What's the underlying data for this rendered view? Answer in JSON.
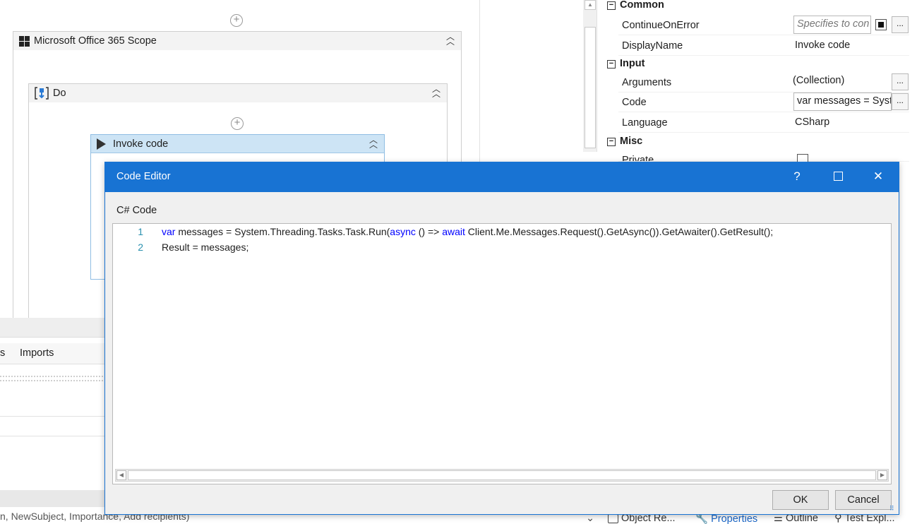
{
  "designer": {
    "scope_title": "Microsoft Office 365 Scope",
    "do_title": "Do",
    "invoke_title": "Invoke code"
  },
  "properties": {
    "categories": {
      "common": "Common",
      "input": "Input",
      "misc": "Misc"
    },
    "rows": {
      "continue_on_error": {
        "name": "ContinueOnError",
        "placeholder": "Specifies to con"
      },
      "display_name": {
        "name": "DisplayName",
        "value": "Invoke code"
      },
      "arguments": {
        "name": "Arguments",
        "value": "(Collection)"
      },
      "code": {
        "name": "Code",
        "value": "var messages = Syst"
      },
      "language": {
        "name": "Language",
        "value": "CSharp"
      },
      "private": {
        "name": "Private"
      }
    },
    "ellipsis": "..."
  },
  "bottom_left": {
    "tab_partial": "s",
    "imports_tab": "Imports",
    "status_text": "n, NewSubject, Importance, Add recipients)"
  },
  "bottom_tabs": {
    "object_repo": "Object Re...",
    "properties": "Properties",
    "outline": "Outline",
    "test_explorer": "Test Expl..."
  },
  "dialog": {
    "title": "Code Editor",
    "help": "?",
    "close": "✕",
    "language_label": "C# Code",
    "ok": "OK",
    "cancel": "Cancel",
    "code_lines": [
      {
        "number": "1",
        "tokens": [
          {
            "text": "var",
            "kind": "keyword"
          },
          {
            "text": " messages = System.Threading.Tasks.Task.Run(",
            "kind": "plain"
          },
          {
            "text": "async",
            "kind": "keyword"
          },
          {
            "text": " () => ",
            "kind": "plain"
          },
          {
            "text": "await",
            "kind": "keyword"
          },
          {
            "text": " Client.Me.Messages.Request().GetAsync()).GetAwaiter().GetResult();",
            "kind": "plain"
          }
        ]
      },
      {
        "number": "2",
        "tokens": [
          {
            "text": "Result = messages;",
            "kind": "plain"
          }
        ]
      }
    ]
  },
  "colors": {
    "accent": "#1873d3",
    "keyword": "#0000ff",
    "line_number": "#2b91af",
    "activity_selected": "#cde4f5"
  }
}
